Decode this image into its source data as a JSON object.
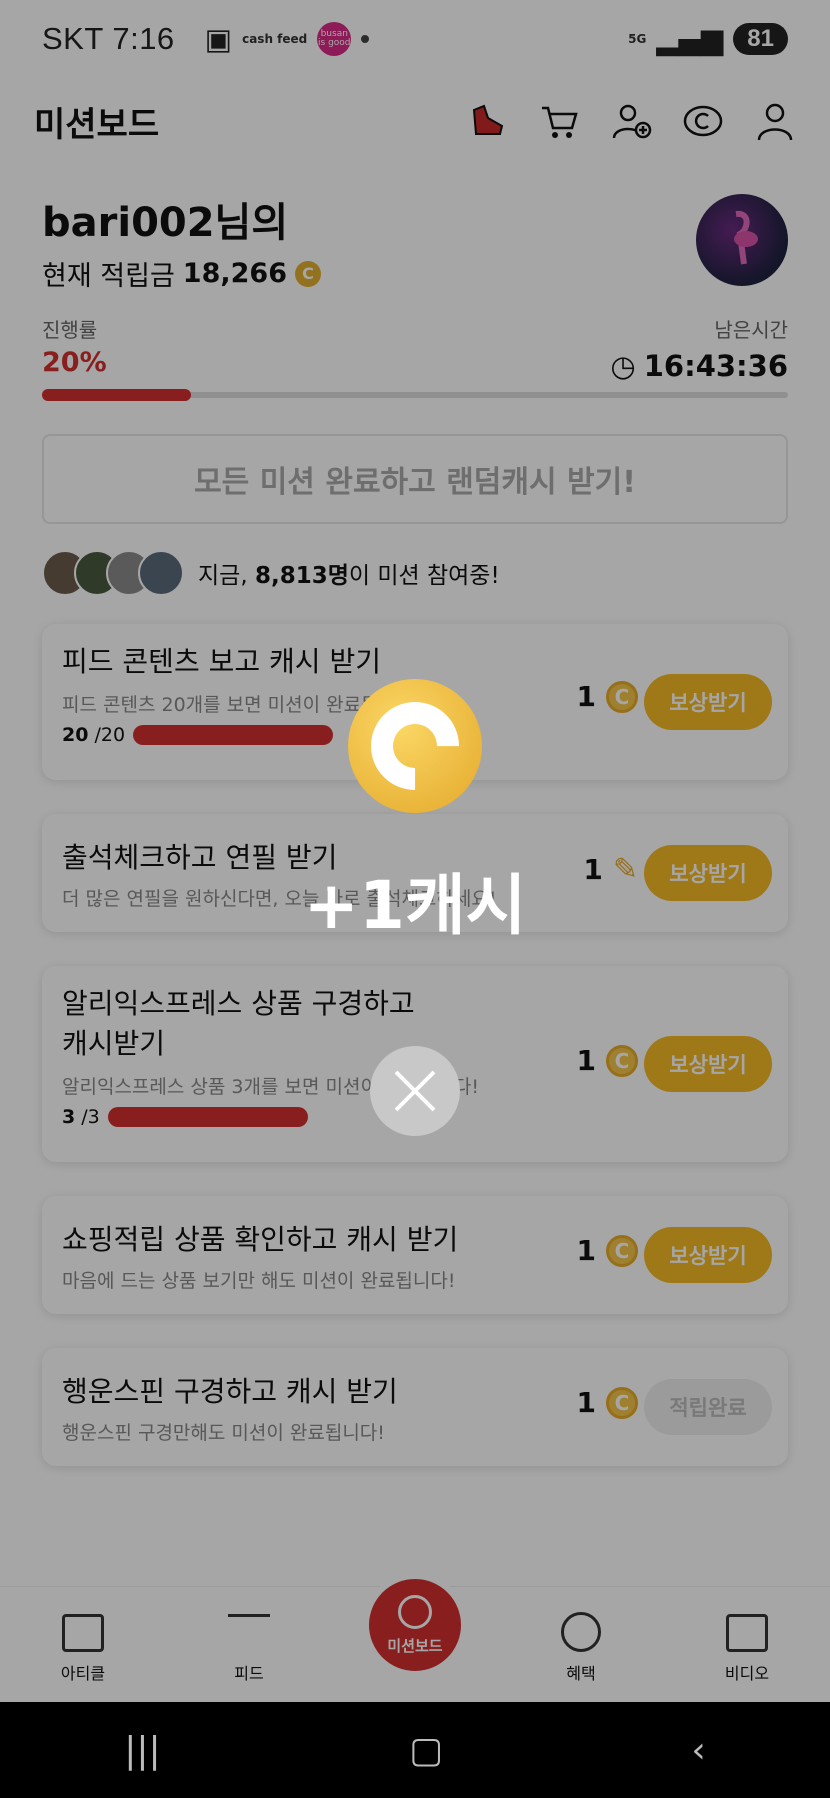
{
  "status_bar": {
    "carrier_time": "SKT 7:16",
    "app1": "cash feed",
    "app2": "busan is good",
    "network": "5G",
    "battery": "81"
  },
  "header": {
    "title": "미션보드",
    "icons": [
      "sneaker-icon",
      "cart-icon",
      "add-friend-icon",
      "cash-icon",
      "profile-icon"
    ]
  },
  "profile": {
    "nickname": "bari002님의",
    "balance_label": "현재 적립금",
    "balance": "18,266",
    "coin_symbol": "C"
  },
  "progress": {
    "label": "진행률",
    "percent_text": "20%",
    "percent": 20,
    "remain_label": "남은시간",
    "remain_time": "16:43:36"
  },
  "all_mission_button": "모든 미션 완료하고 랜덤캐시 받기!",
  "participants": {
    "prefix": "지금, ",
    "count": "8,813명",
    "suffix": "이 미션 참여중!"
  },
  "missions": [
    {
      "title": "피드 콘텐츠 보고 캐시 받기",
      "desc": "피드 콘텐츠 20개를 보면 미션이 완료됩니다!",
      "done": "20",
      "total": "/20",
      "reward": "1",
      "reward_icon": "coin-icon",
      "button": "보상받기"
    },
    {
      "title": "출석체크하고 연필 받기",
      "desc": "더 많은 연필을 원하신다면, 오늘 바로 출석체크하세요!",
      "reward": "1",
      "reward_icon": "pencil-icon",
      "button": "보상받기"
    },
    {
      "title_line1": "알리익스프레스 상품 구경하고",
      "title_line2": "캐시받기",
      "desc": "알리익스프레스 상품 3개를 보면 미션이 완료됩니다!",
      "done": "3",
      "total": "/3",
      "reward": "1",
      "reward_icon": "coin-icon",
      "button": "보상받기"
    },
    {
      "title": "쇼핑적립 상품 확인하고 캐시 받기",
      "desc": "마음에 드는 상품 보기만 해도 미션이 완료됩니다!",
      "reward": "1",
      "reward_icon": "coin-icon",
      "button": "보상받기"
    },
    {
      "title": "행운스핀 구경하고 캐시 받기",
      "desc": "행운스핀 구경만해도 미션이 완료됩니다!",
      "reward": "1",
      "reward_icon": "coin-icon",
      "button": "적립완료"
    }
  ],
  "bottom_nav": [
    {
      "label": "아티클",
      "icon": "article-icon"
    },
    {
      "label": "피드",
      "icon": "feed-icon"
    },
    {
      "label": "미션보드",
      "icon": "target-icon"
    },
    {
      "label": "혜택",
      "icon": "cash-icon"
    },
    {
      "label": "비디오",
      "icon": "video-icon"
    }
  ],
  "popup": {
    "amount_text": "+1캐시",
    "coin_icon": "coin-icon",
    "close_icon": "close-icon"
  },
  "colors": {
    "accent_red": "#d32f2f",
    "coin_gold": "#f5b824"
  }
}
